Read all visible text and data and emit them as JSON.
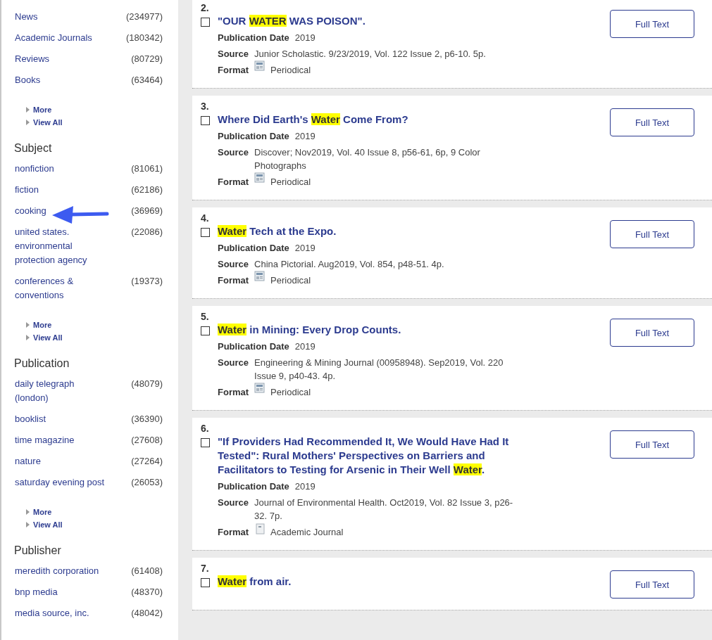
{
  "sidebar": {
    "groups": [
      {
        "items": [
          {
            "label": "News",
            "count": "(234977)"
          },
          {
            "label": "Academic Journals",
            "count": "(180342)"
          },
          {
            "label": "Reviews",
            "count": "(80729)"
          },
          {
            "label": "Books",
            "count": "(63464)"
          }
        ],
        "links": [
          "More",
          "View All"
        ]
      },
      {
        "heading": "Subject",
        "items": [
          {
            "label": "nonfiction",
            "count": "(81061)"
          },
          {
            "label": "fiction",
            "count": "(62186)"
          },
          {
            "label": "cooking",
            "count": "(36969)"
          },
          {
            "label": "united states. environmental protection agency",
            "count": "(22086)"
          },
          {
            "label": "conferences & conventions",
            "count": "(19373)"
          }
        ],
        "links": [
          "More",
          "View All"
        ]
      },
      {
        "heading": "Publication",
        "items": [
          {
            "label": "daily telegraph (london)",
            "count": "(48079)"
          },
          {
            "label": "booklist",
            "count": "(36390)"
          },
          {
            "label": "time magazine",
            "count": "(27608)"
          },
          {
            "label": "nature",
            "count": "(27264)"
          },
          {
            "label": "saturday evening post",
            "count": "(26053)"
          }
        ],
        "links": [
          "More",
          "View All"
        ]
      },
      {
        "heading": "Publisher",
        "items": [
          {
            "label": "meredith corporation",
            "count": "(61408)"
          },
          {
            "label": "bnp media",
            "count": "(48370)"
          },
          {
            "label": "media source, inc.",
            "count": "(48042)"
          }
        ]
      }
    ]
  },
  "results": [
    {
      "number": "2.",
      "checked": false,
      "title": [
        {
          "text": "\"OUR ",
          "highlight": false
        },
        {
          "text": "WATER",
          "highlight": true
        },
        {
          "text": " WAS POISON\".",
          "highlight": false
        }
      ],
      "fields": [
        {
          "label": "Publication Date",
          "value": "2019"
        },
        {
          "label": "Source",
          "value": "Junior Scholastic. 9/23/2019, Vol. 122 Issue 2, p6-10. 5p."
        }
      ],
      "format": {
        "label": "Format",
        "value": "Periodical",
        "kind": "periodical"
      },
      "button": "Full Text"
    },
    {
      "number": "3.",
      "checked": false,
      "title": [
        {
          "text": "Where Did Earth's ",
          "highlight": false
        },
        {
          "text": "Water",
          "highlight": true
        },
        {
          "text": " Come From?",
          "highlight": false
        }
      ],
      "fields": [
        {
          "label": "Publication Date",
          "value": "2019"
        },
        {
          "label": "Source",
          "value": "Discover; Nov2019, Vol. 40 Issue 8, p56-61, 6p, 9 Color Photographs"
        }
      ],
      "format": {
        "label": "Format",
        "value": "Periodical",
        "kind": "periodical"
      },
      "button": "Full Text"
    },
    {
      "number": "4.",
      "checked": false,
      "title": [
        {
          "text": "Water",
          "highlight": true
        },
        {
          "text": " Tech at the Expo.",
          "highlight": false
        }
      ],
      "fields": [
        {
          "label": "Publication Date",
          "value": "2019"
        },
        {
          "label": "Source",
          "value": "China Pictorial. Aug2019, Vol. 854, p48-51. 4p."
        }
      ],
      "format": {
        "label": "Format",
        "value": "Periodical",
        "kind": "periodical"
      },
      "button": "Full Text"
    },
    {
      "number": "5.",
      "checked": false,
      "title": [
        {
          "text": "Water",
          "highlight": true
        },
        {
          "text": " in Mining: Every Drop Counts.",
          "highlight": false
        }
      ],
      "fields": [
        {
          "label": "Publication Date",
          "value": "2019"
        },
        {
          "label": "Source",
          "value": "Engineering & Mining Journal (00958948). Sep2019, Vol. 220 Issue 9, p40-43. 4p."
        }
      ],
      "format": {
        "label": "Format",
        "value": "Periodical",
        "kind": "periodical"
      },
      "button": "Full Text"
    },
    {
      "number": "6.",
      "checked": false,
      "title": [
        {
          "text": "\"If Providers Had Recommended It, We Would Have Had It Tested\": Rural Mothers' Perspectives on Barriers and Facilitators to Testing for Arsenic in Their Well ",
          "highlight": false
        },
        {
          "text": "Water",
          "highlight": true
        },
        {
          "text": ".",
          "highlight": false
        }
      ],
      "fields": [
        {
          "label": "Publication Date",
          "value": "2019"
        },
        {
          "label": "Source",
          "value": "Journal of Environmental Health. Oct2019, Vol. 82 Issue 3, p26-32. 7p."
        }
      ],
      "format": {
        "label": "Format",
        "value": "Academic Journal",
        "kind": "journal"
      },
      "button": "Full Text"
    },
    {
      "number": "7.",
      "checked": false,
      "title": [
        {
          "text": "Water",
          "highlight": true
        },
        {
          "text": " from air.",
          "highlight": false
        }
      ],
      "button": "Full Text"
    }
  ]
}
